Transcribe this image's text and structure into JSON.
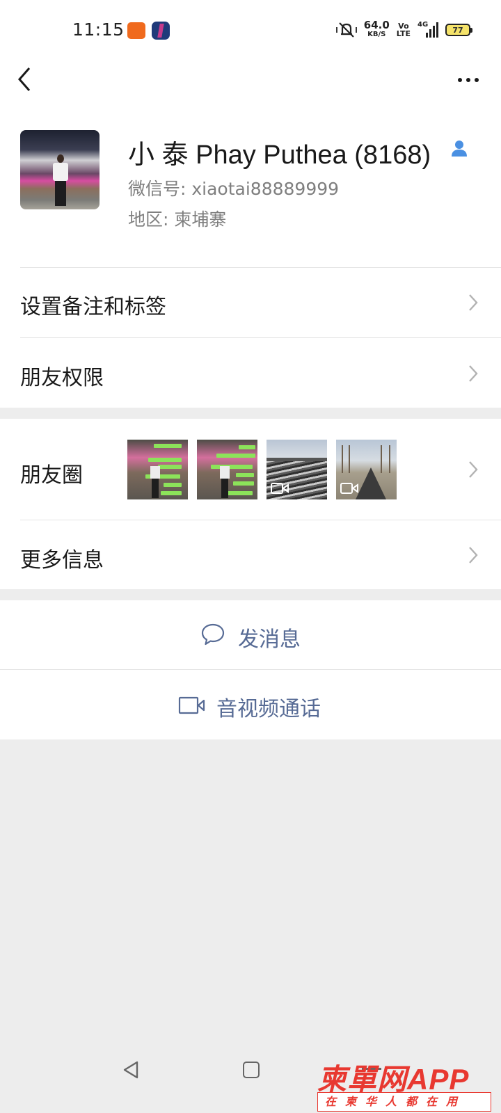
{
  "status_bar": {
    "time": "11:15",
    "net_speed_value": "64.0",
    "net_speed_unit": "KB/S",
    "volte_top": "Vo",
    "volte_bottom": "LTE",
    "network": "4G",
    "battery": "77"
  },
  "profile": {
    "name": "小 泰 Phay Puthea (8168)",
    "wechat_id": "微信号:  xiaotai88889999",
    "region": "地区:  柬埔寨"
  },
  "menu": {
    "remark_tags": "设置备注和标签",
    "friend_permissions": "朋友权限",
    "moments": "朋友圈",
    "more_info": "更多信息"
  },
  "actions": {
    "send_message": "发消息",
    "video_call": "音视频通话"
  },
  "watermark": {
    "brand": "柬單网",
    "app": "APP",
    "slogan": "在柬华人都在用"
  },
  "colors": {
    "link_blue": "#576b95",
    "watermark_red": "#e83830",
    "background": "#ededed"
  }
}
